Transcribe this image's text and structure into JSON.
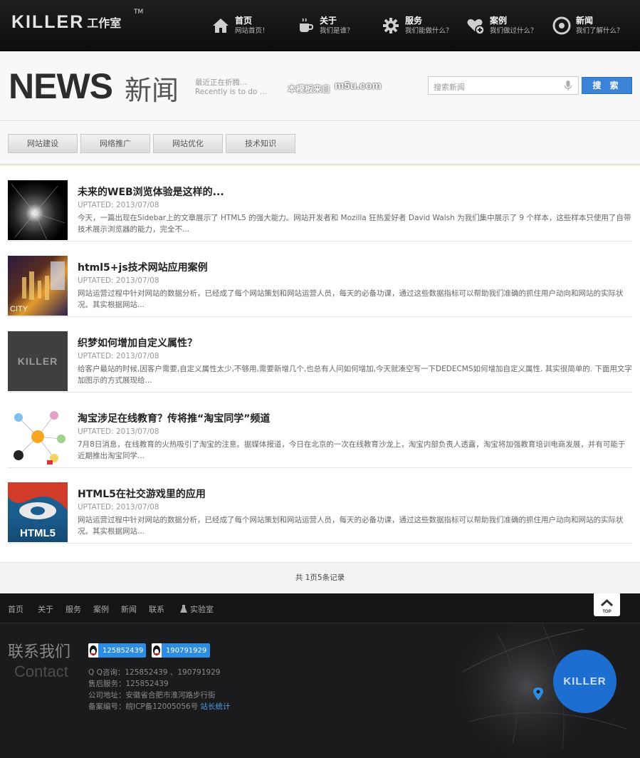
{
  "header": {
    "logo_word": "KILLER",
    "logo_sub": "工作室",
    "logo_tm": "TM",
    "nav": [
      {
        "title": "首页",
        "sub": "网站首页！",
        "icon": "home-icon"
      },
      {
        "title": "关于",
        "sub": "我们是谁？",
        "icon": "coffee-icon"
      },
      {
        "title": "服务",
        "sub": "我们能做什么？",
        "icon": "gear-icon"
      },
      {
        "title": "案例",
        "sub": "我们做过什么？",
        "icon": "heart-plus-icon"
      },
      {
        "title": "新闻",
        "sub": "我们了解什么？",
        "icon": "target-icon"
      }
    ]
  },
  "hero": {
    "title_en": "NEWS",
    "title_cn": "新闻",
    "tagline_cn": "最近正在折腾...",
    "tagline_en": "Recently is to do ...",
    "watermark_text": "本模板来自",
    "watermark_logo": "m5u.com",
    "search_placeholder": "搜索新闻",
    "search_button": "搜 索"
  },
  "categories": [
    "网站建设",
    "网络推广",
    "网站优化",
    "技术知识"
  ],
  "articles": [
    {
      "title": "未来的WEB浏览体验是这样的...",
      "date": "UPTATED: 2013/07/08",
      "desc": "今天，一篇出现在Sidebar上的文章展示了 HTML5 的强大能力。网站开发者和 Mozilla 狂热爱好者 David Walsh 为我们集中展示了 9 个样本，这些样本只使用了自带技术展示浏览器的能力，完全不..."
    },
    {
      "title": "html5+js技术网站应用案例",
      "date": "UPTATED: 2013/07/08",
      "desc": "网站运营过程中针对网站的数据分析，已经成了每个网站策划和网站运营人员，每天的必备功课，通过这些数据指标可以帮助我们准确的抓住用户动向和网站的实际状况。其实根据网站..."
    },
    {
      "title": "织梦如何增加自定义属性？",
      "date": "UPTATED: 2013/07/08",
      "desc": "给客户最站的时候,因客户需要,自定义属性太少,不够用,需要新增几个,也总有人问如何增加,今天就凑空写一下DEDECMS如何增加自定义属性. 其实很简单的. 下面用文字加图示的方式展现给..."
    },
    {
      "title": "淘宝涉足在线教育？传将推“淘宝同学”频道",
      "date": "UPTATED: 2013/07/08",
      "desc": "7月8日消息，在线教育的火热吸引了淘宝的注意。据媒体报道，今日在北京的一次在线教育沙龙上，淘宝内部负责人透露，淘宝将加强教育培训电商发展，并有可能于近期推出淘宝同学..."
    },
    {
      "title": "HTML5在社交游戏里的应用",
      "date": "UPTATED: 2013/07/08",
      "desc": "网站运营过程中针对网站的数据分析，已经成了每个网站策划和网站运营人员，每天的必备功课，通过这些数据指标可以帮助我们准确的抓住用户动向和网站的实际状况。其实根据网站..."
    }
  ],
  "thumb_text": {
    "city": "CITY",
    "killer": "KILLER",
    "html5": "HTML5"
  },
  "pager": "共 1页5条记录",
  "footer": {
    "nav": [
      "首页",
      "关于",
      "服务",
      "案例",
      "新闻",
      "联系",
      "实验室"
    ],
    "top_label": "TOP",
    "contact_cn": "联系我们",
    "contact_en": "Contact",
    "qq": [
      "125852439",
      "190791929"
    ],
    "qq_line": "Q Q咨询：125852439 、190791929",
    "after_sales": "售后服务：125852439",
    "address": "公司地址：安徽省合肥市淮河路步行街",
    "icp": "备案编号：皖ICP备12005056号",
    "stats_link": "站长统计",
    "map_logo": "KILLER"
  },
  "colors": {
    "accent": "#3b82d9",
    "dark": "#1b1b1d"
  }
}
